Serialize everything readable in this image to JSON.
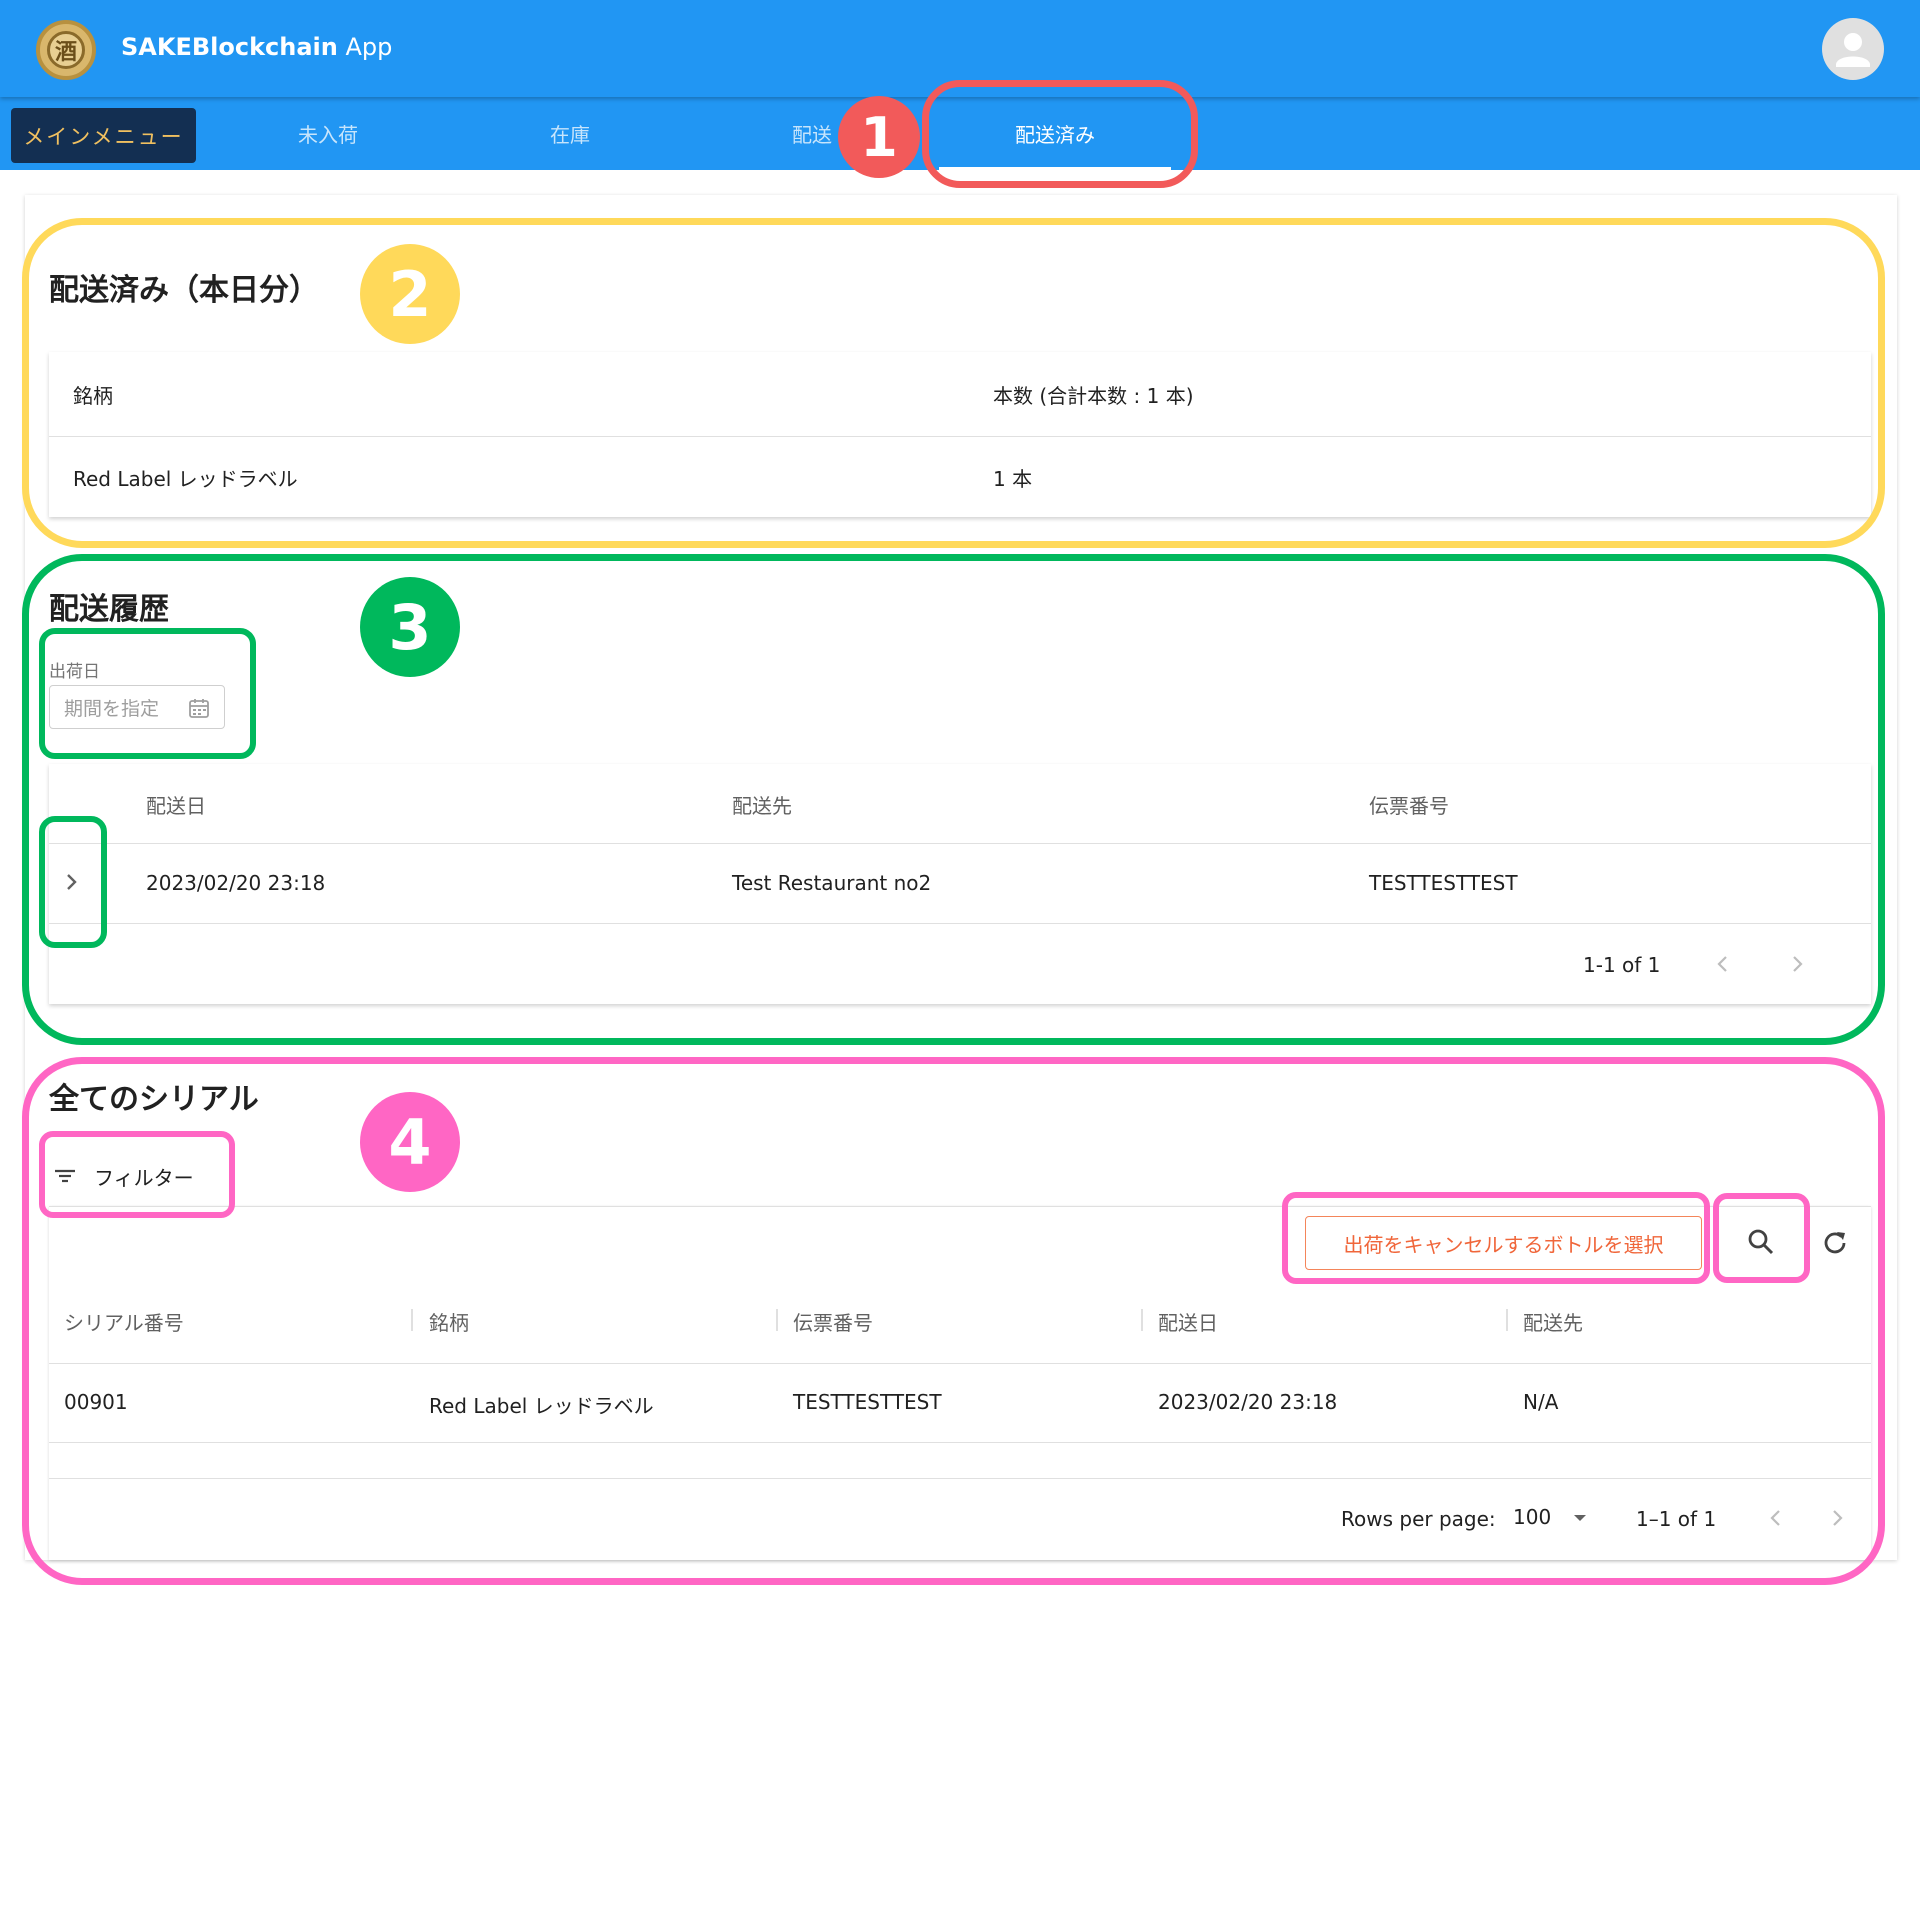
{
  "app": {
    "title_bold": "SAKEBlockchain",
    "title_rest": " App",
    "logo_char": "酒"
  },
  "tabs": {
    "menu": "メインメニュー",
    "items": [
      "未入荷",
      "在庫",
      "配送",
      "配送済み"
    ],
    "active_index": 3
  },
  "today": {
    "title": "配送済み（本日分）",
    "headers": [
      "銘柄",
      "本数 (合計本数 : 1 本)"
    ],
    "rows": [
      [
        "Red Label レッドラベル",
        "1 本"
      ]
    ]
  },
  "history": {
    "title": "配送履歴",
    "date_label": "出荷日",
    "date_placeholder": "期間を指定",
    "headers": [
      "配送日",
      "配送先",
      "伝票番号"
    ],
    "rows": [
      [
        "2023/02/20 23:18",
        "Test Restaurant no2",
        "TESTTESTTEST"
      ]
    ],
    "pagination": "1-1 of 1"
  },
  "serials": {
    "title": "全てのシリアル",
    "filter_label": "フィルター",
    "cancel_button": "出荷をキャンセルするボトルを選択",
    "headers": [
      "シリアル番号",
      "銘柄",
      "伝票番号",
      "配送日",
      "配送先"
    ],
    "rows": [
      [
        "00901",
        "Red Label レッドラベル",
        "TESTTESTTEST",
        "2023/02/20 23:18",
        "N/A"
      ]
    ],
    "rows_per_page_label": "Rows per page:",
    "rows_per_page_value": "100",
    "pagination": "1–1 of 1"
  },
  "annotations": {
    "badges": [
      "1",
      "2",
      "3",
      "4"
    ],
    "colors": {
      "red": "#f25a5a",
      "yellow": "#ffd95a",
      "green": "#00b85c",
      "pink": "#ff66c4"
    }
  },
  "colors": {
    "primary": "#2196f3",
    "menu_bg": "#132f52",
    "menu_text": "#f0c060",
    "cancel_accent": "#f0663a"
  }
}
